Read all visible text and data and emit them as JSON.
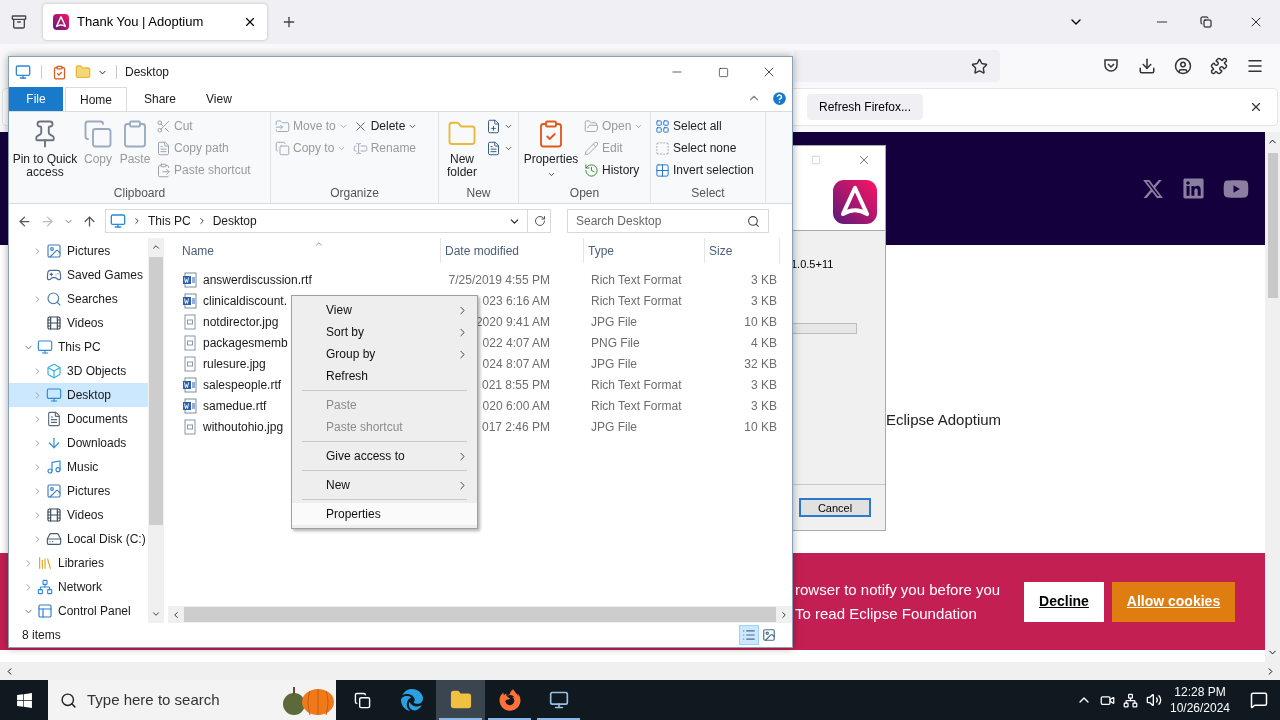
{
  "browser": {
    "tabs": [
      {
        "title": "Thank You | Adoptium",
        "selected": true
      }
    ],
    "notification": {
      "button": "Refresh Firefox..."
    },
    "page": {
      "body_text": "Eclipse Adoptium",
      "cookie_banner": {
        "lines": [
          "rowser to notify you before you",
          "To read Eclipse Foundation"
        ],
        "buttons": [
          {
            "label": "Decline",
            "kind": "decline"
          },
          {
            "label": "Allow cookies",
            "kind": "allow"
          }
        ]
      }
    }
  },
  "installer": {
    "version_text": "1.0.5+11",
    "progress": {
      "level": 0
    },
    "cancel": "Cancel"
  },
  "explorer": {
    "title": "Desktop",
    "ribbon": {
      "tabs": [
        {
          "label": "File",
          "kind": "file",
          "selected": false
        },
        {
          "label": "Home",
          "kind": "tab",
          "selected": true
        },
        {
          "label": "Share",
          "kind": "tab",
          "selected": false
        },
        {
          "label": "View",
          "kind": "tab",
          "selected": false
        }
      ],
      "groups": [
        {
          "name": "Clipboard",
          "columns": [
            [
              {
                "label": "Pin to Quick access",
                "kind": "pin",
                "disabled": false
              }
            ],
            [
              {
                "label": "Copy",
                "kind": "copy",
                "disabled": true
              }
            ],
            [
              {
                "label": "Paste",
                "kind": "paste",
                "disabled": true
              }
            ],
            [
              {
                "label": "Cut",
                "kind": "cut",
                "disabled": true
              },
              {
                "label": "Copy path",
                "kind": "copypath",
                "disabled": true
              },
              {
                "label": "Paste shortcut",
                "kind": "pasteshortcut",
                "disabled": true
              }
            ]
          ]
        },
        {
          "name": "Organize",
          "columns": [
            [
              {
                "label": "Move to",
                "kind": "move",
                "disabled": true,
                "dropdown": true
              },
              {
                "label": "Copy to",
                "kind": "copyto",
                "disabled": true,
                "dropdown": true
              }
            ],
            [
              {
                "label": "Delete",
                "kind": "delete",
                "disabled": false,
                "dropdown": true
              },
              {
                "label": "Rename",
                "kind": "rename",
                "disabled": true
              }
            ]
          ]
        },
        {
          "name": "New",
          "columns": [
            [
              {
                "label": "New folder",
                "kind": "newfolder",
                "disabled": false
              }
            ],
            [
              {
                "kind": "newitem",
                "disabled": false,
                "dropdown": true
              },
              {
                "kind": "easyaccess",
                "disabled": false,
                "dropdown": true
              }
            ]
          ]
        },
        {
          "name": "Open",
          "columns": [
            [
              {
                "label": "Properties",
                "kind": "properties",
                "disabled": false,
                "dropdown": true
              }
            ],
            [
              {
                "label": "Open",
                "kind": "open",
                "disabled": true,
                "dropdown": true
              },
              {
                "label": "Edit",
                "kind": "edit",
                "disabled": true
              },
              {
                "label": "History",
                "kind": "history",
                "disabled": false
              }
            ]
          ]
        },
        {
          "name": "Select",
          "columns": [
            [
              {
                "label": "Select all",
                "kind": "selectall",
                "disabled": false
              },
              {
                "label": "Select none",
                "kind": "selectnone",
                "disabled": false
              },
              {
                "label": "Invert selection",
                "kind": "invert",
                "disabled": false
              }
            ]
          ]
        }
      ]
    },
    "address": {
      "crumbs": [
        "This PC",
        "Desktop"
      ]
    },
    "search": {
      "placeholder": "Search Desktop"
    },
    "nav": {
      "scrolled_items": [
        {
          "label": "Pictures",
          "kind": "pictures",
          "expandable": true,
          "expanded": false,
          "selected": false
        },
        {
          "label": "Saved Games",
          "kind": "games",
          "expandable": false,
          "selected": false
        },
        {
          "label": "Searches",
          "kind": "searches",
          "expandable": true,
          "expanded": false,
          "selected": false
        },
        {
          "label": "Videos",
          "kind": "videos",
          "expandable": false,
          "selected": false
        }
      ],
      "items": [
        {
          "label": "This PC",
          "kind": "pc",
          "expandable": true,
          "expanded": true,
          "selected": false,
          "children": [
            {
              "label": "3D Objects",
              "kind": "objects",
              "expandable": true,
              "expanded": false,
              "selected": false
            },
            {
              "label": "Desktop",
              "kind": "desktop",
              "expandable": true,
              "expanded": false,
              "selected": true
            },
            {
              "label": "Documents",
              "kind": "documents",
              "expandable": true,
              "expanded": false,
              "selected": false
            },
            {
              "label": "Downloads",
              "kind": "downloads",
              "expandable": true,
              "expanded": false,
              "selected": false
            },
            {
              "label": "Music",
              "kind": "music",
              "expandable": true,
              "expanded": false,
              "selected": false
            },
            {
              "label": "Pictures",
              "kind": "pictures",
              "expandable": true,
              "expanded": false,
              "selected": false
            },
            {
              "label": "Videos",
              "kind": "videos",
              "expandable": true,
              "expanded": false,
              "selected": false
            },
            {
              "label": "Local Disk (C:)",
              "kind": "disk",
              "expandable": true,
              "expanded": false,
              "selected": false
            }
          ]
        },
        {
          "label": "Libraries",
          "kind": "libraries",
          "expandable": true,
          "expanded": false,
          "selected": false
        },
        {
          "label": "Network",
          "kind": "network",
          "expandable": true,
          "expanded": false,
          "selected": false
        },
        {
          "label": "Control Panel",
          "kind": "control",
          "expandable": true,
          "expanded": true,
          "selected": false
        }
      ]
    },
    "columns": [
      "Name",
      "Date modified",
      "Type",
      "Size"
    ],
    "files": [
      {
        "name": "answerdiscussion.rtf",
        "date": "7/25/2019 4:55 PM",
        "type": "Rich Text Format",
        "size": "3 KB",
        "kind": "rtf"
      },
      {
        "name": "clinicaldiscount.",
        "date": "023 6:16 AM",
        "type": "Rich Text Format",
        "size": "3 KB",
        "kind": "rtf"
      },
      {
        "name": "notdirector.jpg",
        "date": "2020 9:41 AM",
        "type": "JPG File",
        "size": "10 KB",
        "kind": "image"
      },
      {
        "name": "packagesmemb",
        "date": "022 4:07 AM",
        "type": "PNG File",
        "size": "4 KB",
        "kind": "image"
      },
      {
        "name": "rulesure.jpg",
        "date": "024 8:07 AM",
        "type": "JPG File",
        "size": "32 KB",
        "kind": "image"
      },
      {
        "name": "salespeople.rtf",
        "date": "021 8:55 PM",
        "type": "Rich Text Format",
        "size": "3 KB",
        "kind": "rtf"
      },
      {
        "name": "samedue.rtf",
        "date": "020 6:00 AM",
        "type": "Rich Text Format",
        "size": "3 KB",
        "kind": "rtf"
      },
      {
        "name": "withoutohio.jpg",
        "date": "017 2:46 PM",
        "type": "JPG File",
        "size": "10 KB",
        "kind": "image"
      }
    ],
    "status": "8 items",
    "views": [
      {
        "kind": "details",
        "selected": true
      },
      {
        "kind": "tiles",
        "selected": false
      }
    ]
  },
  "context_menu": [
    {
      "label": "View",
      "kind": "submenu",
      "disabled": false,
      "highlighted": false
    },
    {
      "label": "Sort by",
      "kind": "submenu",
      "disabled": false,
      "highlighted": false
    },
    {
      "label": "Group by",
      "kind": "submenu",
      "disabled": false,
      "highlighted": false
    },
    {
      "label": "Refresh",
      "kind": "item",
      "disabled": false,
      "highlighted": false
    },
    {
      "kind": "separator"
    },
    {
      "label": "Paste",
      "kind": "item",
      "disabled": true,
      "highlighted": false
    },
    {
      "label": "Paste shortcut",
      "kind": "item",
      "disabled": true,
      "highlighted": false
    },
    {
      "kind": "separator"
    },
    {
      "label": "Give access to",
      "kind": "submenu",
      "disabled": false,
      "highlighted": false
    },
    {
      "kind": "separator"
    },
    {
      "label": "New",
      "kind": "submenu",
      "disabled": false,
      "highlighted": false
    },
    {
      "kind": "separator"
    },
    {
      "label": "Properties",
      "kind": "item",
      "disabled": false,
      "highlighted": true
    }
  ],
  "taskbar": {
    "search_placeholder": "Type here to search",
    "apps": [
      {
        "kind": "taskview",
        "active": false,
        "running": false
      },
      {
        "kind": "edge",
        "active": false,
        "running": false
      },
      {
        "kind": "explorer",
        "active": true,
        "running": true
      },
      {
        "kind": "firefox",
        "active": false,
        "running": true
      },
      {
        "kind": "installer",
        "active": false,
        "running": true
      }
    ],
    "time": "12:28 PM",
    "date": "10/26/2024"
  }
}
